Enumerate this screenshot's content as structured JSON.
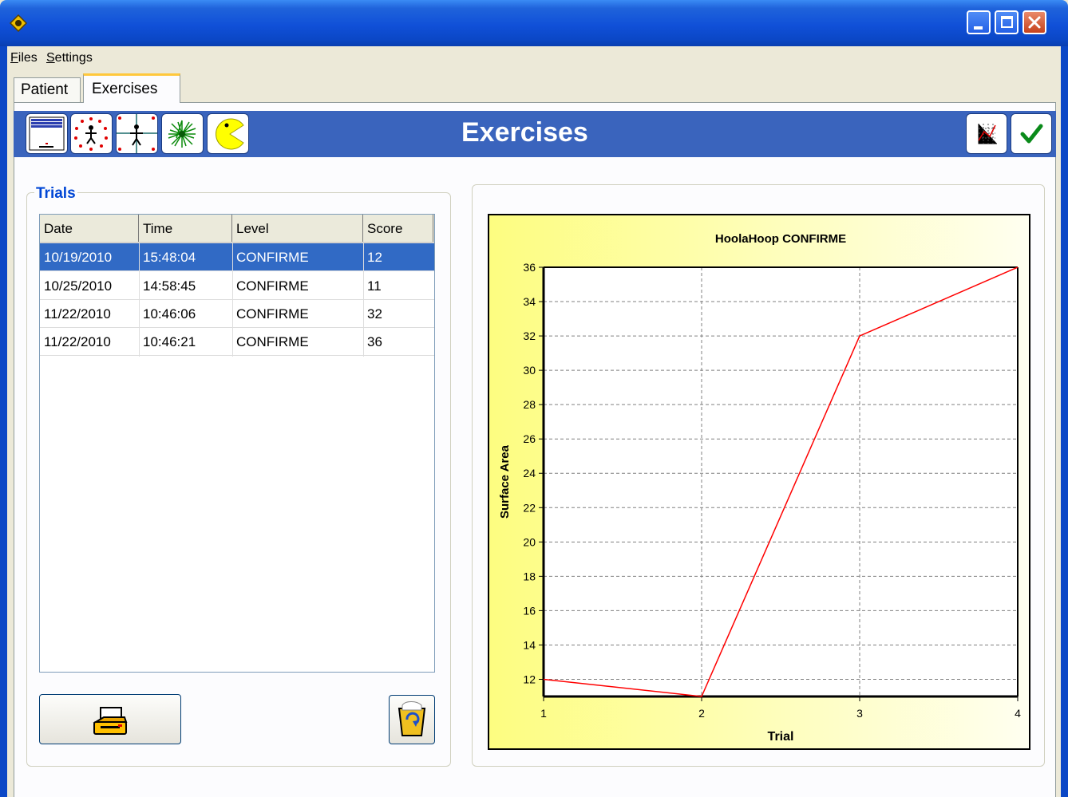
{
  "menu": {
    "files": "Files",
    "settings": "Settings"
  },
  "tabs": [
    {
      "label": "Patient"
    },
    {
      "label": "Exercises"
    }
  ],
  "header": {
    "title": "Exercises"
  },
  "trials": {
    "legend": "Trials",
    "columns": [
      "Date",
      "Time",
      "Level",
      "Score"
    ],
    "rows": [
      {
        "date": "10/19/2010",
        "time": "15:48:04",
        "level": "CONFIRME",
        "score": "12",
        "selected": true
      },
      {
        "date": "10/25/2010",
        "time": "14:58:45",
        "level": "CONFIRME",
        "score": "11"
      },
      {
        "date": "11/22/2010",
        "time": "10:46:06",
        "level": "CONFIRME",
        "score": "32"
      },
      {
        "date": "11/22/2010",
        "time": "10:46:21",
        "level": "CONFIRME",
        "score": "36"
      }
    ]
  },
  "icons": {
    "app": "app-logo-icon",
    "toolbar": [
      "grid-exercise-icon",
      "dotted-circle-figure-icon",
      "crosshair-figure-icon",
      "starburst-icon",
      "pacman-icon"
    ],
    "right": [
      "graph-icon",
      "checkmark-icon"
    ],
    "print": "printer-icon",
    "delete": "recycle-bin-icon"
  },
  "colors": {
    "selection": "#316ac5",
    "header_bar": "#3a64bd",
    "legend_blue": "#0046d5",
    "series_line": "#ff0000"
  },
  "chart_data": {
    "type": "line",
    "title": "HoolaHoop CONFIRME",
    "xlabel": "Trial",
    "ylabel": "Surface Area",
    "x": [
      1,
      2,
      3,
      4
    ],
    "series": [
      {
        "values": [
          12,
          11,
          32,
          36
        ]
      }
    ],
    "xlim": [
      1,
      4
    ],
    "ylim": [
      11,
      36
    ],
    "xticks": [
      1,
      2,
      3,
      4
    ],
    "yticks": [
      12,
      14,
      16,
      18,
      20,
      22,
      24,
      26,
      28,
      30,
      32,
      34,
      36
    ],
    "grid": true
  }
}
